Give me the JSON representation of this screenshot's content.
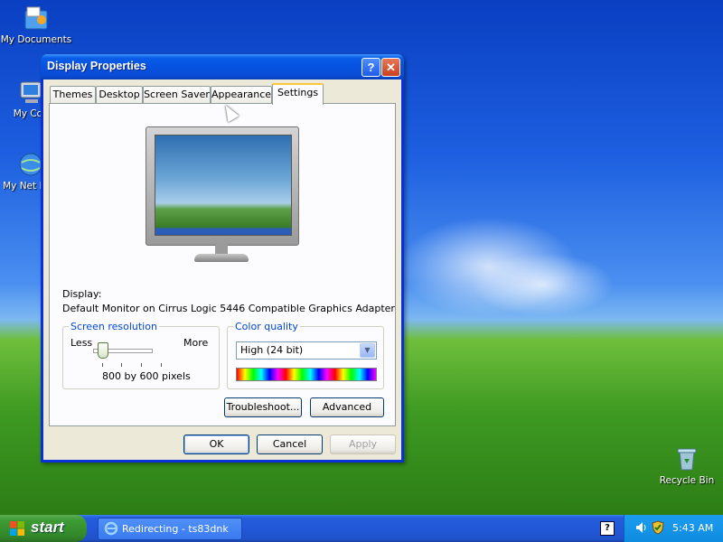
{
  "desktop": {
    "icons": [
      {
        "label": "My Documents"
      },
      {
        "label": "My Com"
      },
      {
        "label": "My Net Plac"
      },
      {
        "label": "Recycle Bin"
      }
    ]
  },
  "window": {
    "title": "Display Properties",
    "help_label": "?",
    "close_label": "✕",
    "tabs": [
      {
        "label": "Themes"
      },
      {
        "label": "Desktop"
      },
      {
        "label": "Screen Saver"
      },
      {
        "label": "Appearance"
      },
      {
        "label": "Settings"
      }
    ],
    "active_tab": "Settings",
    "display_label": "Display:",
    "display_value": "Default Monitor on Cirrus Logic 5446 Compatible Graphics Adapter",
    "screen_resolution": {
      "legend": "Screen resolution",
      "less_label": "Less",
      "more_label": "More",
      "value_text": "800 by 600 pixels"
    },
    "color_quality": {
      "legend": "Color quality",
      "selected": "High (24 bit)"
    },
    "buttons": {
      "troubleshoot": "Troubleshoot...",
      "advanced": "Advanced",
      "ok": "OK",
      "cancel": "Cancel",
      "apply": "Apply"
    }
  },
  "taskbar": {
    "start_label": "start",
    "task_item": "Redirecting - ts83dnk",
    "clock": "5:43 AM"
  }
}
